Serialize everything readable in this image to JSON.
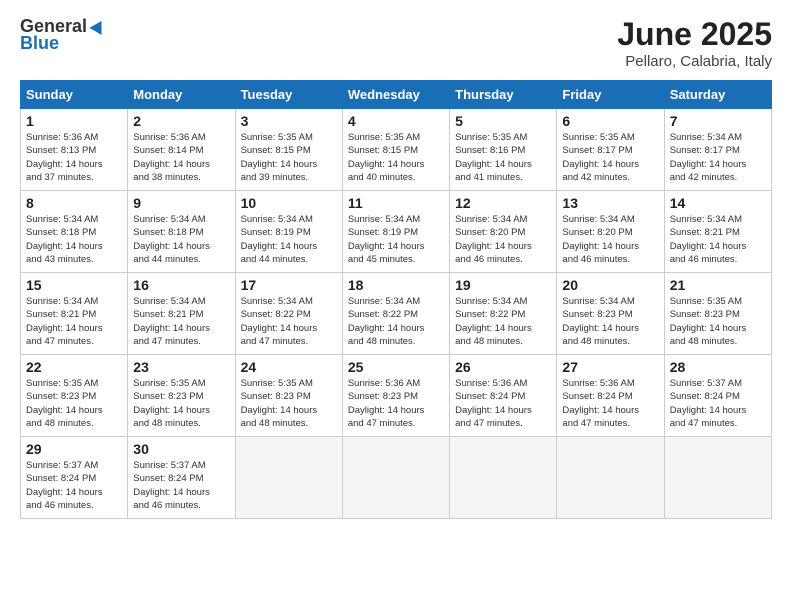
{
  "logo": {
    "line1": "General",
    "line2": "Blue"
  },
  "title": "June 2025",
  "location": "Pellaro, Calabria, Italy",
  "weekdays": [
    "Sunday",
    "Monday",
    "Tuesday",
    "Wednesday",
    "Thursday",
    "Friday",
    "Saturday"
  ],
  "weeks": [
    [
      {
        "day": "1",
        "info": "Sunrise: 5:36 AM\nSunset: 8:13 PM\nDaylight: 14 hours\nand 37 minutes."
      },
      {
        "day": "2",
        "info": "Sunrise: 5:36 AM\nSunset: 8:14 PM\nDaylight: 14 hours\nand 38 minutes."
      },
      {
        "day": "3",
        "info": "Sunrise: 5:35 AM\nSunset: 8:15 PM\nDaylight: 14 hours\nand 39 minutes."
      },
      {
        "day": "4",
        "info": "Sunrise: 5:35 AM\nSunset: 8:15 PM\nDaylight: 14 hours\nand 40 minutes."
      },
      {
        "day": "5",
        "info": "Sunrise: 5:35 AM\nSunset: 8:16 PM\nDaylight: 14 hours\nand 41 minutes."
      },
      {
        "day": "6",
        "info": "Sunrise: 5:35 AM\nSunset: 8:17 PM\nDaylight: 14 hours\nand 42 minutes."
      },
      {
        "day": "7",
        "info": "Sunrise: 5:34 AM\nSunset: 8:17 PM\nDaylight: 14 hours\nand 42 minutes."
      }
    ],
    [
      {
        "day": "8",
        "info": "Sunrise: 5:34 AM\nSunset: 8:18 PM\nDaylight: 14 hours\nand 43 minutes."
      },
      {
        "day": "9",
        "info": "Sunrise: 5:34 AM\nSunset: 8:18 PM\nDaylight: 14 hours\nand 44 minutes."
      },
      {
        "day": "10",
        "info": "Sunrise: 5:34 AM\nSunset: 8:19 PM\nDaylight: 14 hours\nand 44 minutes."
      },
      {
        "day": "11",
        "info": "Sunrise: 5:34 AM\nSunset: 8:19 PM\nDaylight: 14 hours\nand 45 minutes."
      },
      {
        "day": "12",
        "info": "Sunrise: 5:34 AM\nSunset: 8:20 PM\nDaylight: 14 hours\nand 46 minutes."
      },
      {
        "day": "13",
        "info": "Sunrise: 5:34 AM\nSunset: 8:20 PM\nDaylight: 14 hours\nand 46 minutes."
      },
      {
        "day": "14",
        "info": "Sunrise: 5:34 AM\nSunset: 8:21 PM\nDaylight: 14 hours\nand 46 minutes."
      }
    ],
    [
      {
        "day": "15",
        "info": "Sunrise: 5:34 AM\nSunset: 8:21 PM\nDaylight: 14 hours\nand 47 minutes."
      },
      {
        "day": "16",
        "info": "Sunrise: 5:34 AM\nSunset: 8:21 PM\nDaylight: 14 hours\nand 47 minutes."
      },
      {
        "day": "17",
        "info": "Sunrise: 5:34 AM\nSunset: 8:22 PM\nDaylight: 14 hours\nand 47 minutes."
      },
      {
        "day": "18",
        "info": "Sunrise: 5:34 AM\nSunset: 8:22 PM\nDaylight: 14 hours\nand 48 minutes."
      },
      {
        "day": "19",
        "info": "Sunrise: 5:34 AM\nSunset: 8:22 PM\nDaylight: 14 hours\nand 48 minutes."
      },
      {
        "day": "20",
        "info": "Sunrise: 5:34 AM\nSunset: 8:23 PM\nDaylight: 14 hours\nand 48 minutes."
      },
      {
        "day": "21",
        "info": "Sunrise: 5:35 AM\nSunset: 8:23 PM\nDaylight: 14 hours\nand 48 minutes."
      }
    ],
    [
      {
        "day": "22",
        "info": "Sunrise: 5:35 AM\nSunset: 8:23 PM\nDaylight: 14 hours\nand 48 minutes."
      },
      {
        "day": "23",
        "info": "Sunrise: 5:35 AM\nSunset: 8:23 PM\nDaylight: 14 hours\nand 48 minutes."
      },
      {
        "day": "24",
        "info": "Sunrise: 5:35 AM\nSunset: 8:23 PM\nDaylight: 14 hours\nand 48 minutes."
      },
      {
        "day": "25",
        "info": "Sunrise: 5:36 AM\nSunset: 8:23 PM\nDaylight: 14 hours\nand 47 minutes."
      },
      {
        "day": "26",
        "info": "Sunrise: 5:36 AM\nSunset: 8:24 PM\nDaylight: 14 hours\nand 47 minutes."
      },
      {
        "day": "27",
        "info": "Sunrise: 5:36 AM\nSunset: 8:24 PM\nDaylight: 14 hours\nand 47 minutes."
      },
      {
        "day": "28",
        "info": "Sunrise: 5:37 AM\nSunset: 8:24 PM\nDaylight: 14 hours\nand 47 minutes."
      }
    ],
    [
      {
        "day": "29",
        "info": "Sunrise: 5:37 AM\nSunset: 8:24 PM\nDaylight: 14 hours\nand 46 minutes."
      },
      {
        "day": "30",
        "info": "Sunrise: 5:37 AM\nSunset: 8:24 PM\nDaylight: 14 hours\nand 46 minutes."
      },
      {
        "day": "",
        "info": ""
      },
      {
        "day": "",
        "info": ""
      },
      {
        "day": "",
        "info": ""
      },
      {
        "day": "",
        "info": ""
      },
      {
        "day": "",
        "info": ""
      }
    ]
  ]
}
